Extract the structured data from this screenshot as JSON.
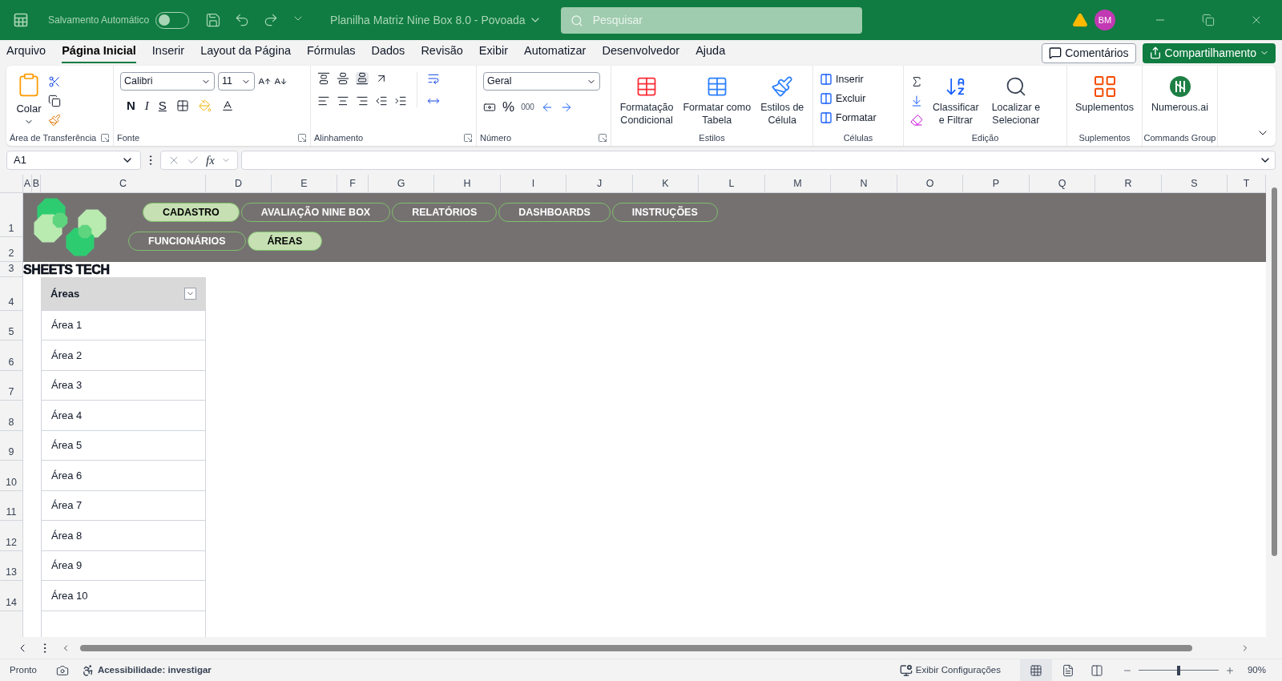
{
  "titlebar": {
    "autosave_label": "Salvamento Automático",
    "autosave_on": false,
    "document_title": "Planilha Matriz Nine Box 8.0 - Povoada",
    "search": {
      "placeholder": "Pesquisar"
    },
    "avatar": "BM"
  },
  "menu_tabs": [
    {
      "label": "Arquivo",
      "selected": false
    },
    {
      "label": "Página Inicial",
      "selected": true
    },
    {
      "label": "Inserir",
      "selected": false
    },
    {
      "label": "Layout da Página",
      "selected": false
    },
    {
      "label": "Fórmulas",
      "selected": false
    },
    {
      "label": "Dados",
      "selected": false
    },
    {
      "label": "Revisão",
      "selected": false
    },
    {
      "label": "Exibir",
      "selected": false
    },
    {
      "label": "Automatizar",
      "selected": false
    },
    {
      "label": "Desenvolvedor",
      "selected": false
    },
    {
      "label": "Ajuda",
      "selected": false
    }
  ],
  "actions": {
    "comments": "Comentários",
    "share": "Compartilhamento"
  },
  "ribbon": [
    {
      "kind": "clipboard",
      "label": "Área de Transferência",
      "paste": "Colar"
    },
    {
      "kind": "font",
      "label": "Fonte",
      "font": "Calibri",
      "size": "11",
      "bold": "N",
      "italic": "I",
      "underline": "S"
    },
    {
      "kind": "alignment",
      "label": "Alinhamento"
    },
    {
      "kind": "number",
      "label": "Número",
      "format": "Geral",
      "percent": "%",
      "thousands": "000"
    },
    {
      "kind": "large",
      "label": "Estilos",
      "buttons": [
        {
          "kind": "conditional",
          "lines": [
            "Formatação",
            "Condicional"
          ]
        },
        {
          "kind": "table",
          "lines": [
            "Formatar como",
            "Tabela"
          ]
        },
        {
          "kind": "cellstyle",
          "lines": [
            "Estilos de",
            "Célula"
          ]
        }
      ]
    },
    {
      "kind": "cells",
      "label": "Células",
      "buttons": [
        "Inserir",
        "Excluir",
        "Formatar"
      ]
    },
    {
      "kind": "editing",
      "label": "Edição",
      "buttons": [
        {
          "kind": "sort",
          "lines": [
            "Classificar",
            "e Filtrar"
          ]
        },
        {
          "kind": "find",
          "lines": [
            "Localizar e",
            "Selecionar"
          ]
        }
      ]
    },
    {
      "kind": "large",
      "label": "Suplementos",
      "buttons": [
        {
          "kind": "addins",
          "lines": [
            "Suplementos"
          ]
        }
      ]
    },
    {
      "kind": "large",
      "label": "Commands Group",
      "buttons": [
        {
          "kind": "numerous",
          "lines": [
            "Numerous.ai"
          ]
        }
      ]
    }
  ],
  "formula_bar": {
    "name_box": "A1",
    "fx": "fx"
  },
  "columns": [
    "A",
    "B",
    "C",
    "D",
    "E",
    "F",
    "G",
    "H",
    "I",
    "J",
    "K",
    "L",
    "M",
    "N",
    "O",
    "P",
    "Q",
    "R",
    "S",
    "T"
  ],
  "rows": [
    "1",
    "2",
    "3",
    "4",
    "5",
    "6",
    "7",
    "8",
    "9",
    "10",
    "11",
    "12",
    "13",
    "14"
  ],
  "banner": {
    "brand": "SHEETS TECH",
    "nav": [
      [
        {
          "label": "CADASTRO",
          "selected": true
        },
        {
          "label": "AVALIAÇÃO NINE BOX",
          "selected": false
        },
        {
          "label": "RELATÓRIOS",
          "selected": false
        },
        {
          "label": "DASHBOARDS",
          "selected": false
        },
        {
          "label": "INSTRUÇÕES",
          "selected": false
        }
      ],
      [
        {
          "label": "FUNCIONÁRIOS",
          "selected": false
        },
        {
          "label": "ÁREAS",
          "selected": true
        }
      ]
    ]
  },
  "table": {
    "header": "Áreas",
    "rows": [
      "Área 1",
      "Área 2",
      "Área 3",
      "Área 4",
      "Área 5",
      "Área 6",
      "Área 7",
      "Área 8",
      "Área 9",
      "Área 10"
    ]
  },
  "status_bar": {
    "ready": "Pronto",
    "accessibility": "Acessibilidade: investigar",
    "display_settings": "Exibir Configurações",
    "zoom": "90%",
    "zoom_slider": {
      "level": 0.5
    }
  }
}
